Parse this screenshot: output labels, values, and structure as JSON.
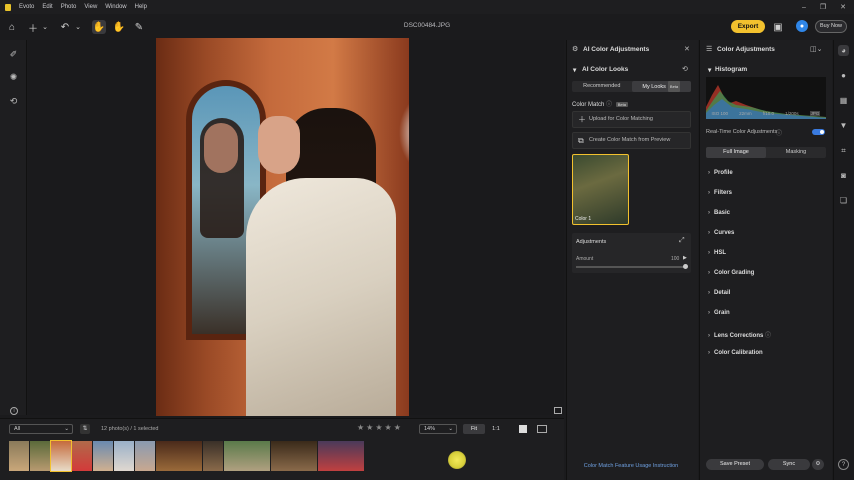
{
  "menubar": {
    "items": [
      "Evoto",
      "Edit",
      "Photo",
      "View",
      "Window",
      "Help"
    ],
    "window_controls": [
      "–",
      "❐",
      "✕"
    ]
  },
  "toolbar": {
    "filename": "DSC00484.JPG",
    "export_label": "Export",
    "buy_label": "Buy Now"
  },
  "filmstrip": {
    "filter_value": "All",
    "count_text": "12 photo(s) / 1 selected",
    "stars": "★★★★★",
    "zoom_value": "14%",
    "fit_label": "Fit",
    "one_label": "1:1"
  },
  "ai_panel": {
    "title": "AI Color Adjustments",
    "looks_title": "AI Color Looks",
    "tabs": [
      "Recommended",
      "My Looks"
    ],
    "tab_badge": "Beta",
    "color_match_label": "Color Match",
    "color_match_badge": "Beta",
    "upload_label": "Upload for Color Matching",
    "create_label": "Create Color Match from Preview",
    "card_label": "Color 1",
    "adjustments_label": "Adjustments",
    "amount_label": "Amount",
    "amount_value": "100",
    "amount_fraction": 1.0,
    "instructions_link": "Color Match Feature Usage Instruction"
  },
  "color_panel": {
    "title": "Color Adjustments",
    "histogram_label": "Histogram",
    "histo_info": [
      "ISO 100",
      "22mm",
      "f/10.0",
      "1/200s"
    ],
    "histo_badge": "JPG",
    "realtime_label": "Real-Time Color Adjustments",
    "realtime_on": true,
    "scope_tabs": [
      "Full Image",
      "Masking"
    ],
    "sections": [
      "Profile",
      "Filters",
      "Basic",
      "Curves",
      "HSL",
      "Color Grading",
      "Detail",
      "Grain",
      "Lens Corrections",
      "Color Calibration"
    ],
    "save_preset_label": "Save Preset",
    "sync_label": "Sync"
  },
  "colors": {
    "accent": "#f2c12e",
    "toggle_blue": "#3a7be0",
    "link_blue": "#6fa0e0"
  }
}
